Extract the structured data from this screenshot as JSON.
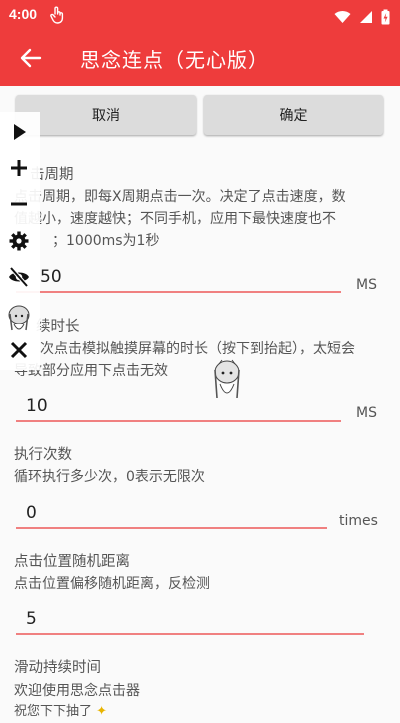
{
  "status": {
    "time": "4:00"
  },
  "app": {
    "title": "思念连点（无心版）"
  },
  "actions": {
    "cancel": "取消",
    "confirm": "确定"
  },
  "settings": {
    "period": {
      "label": "点击周期",
      "label_visible": "击周期",
      "desc_line1": "点击周期，即每X周期点击一次。决定了点击速度，数",
      "desc_line2": "值越小，速度越快；不同手机，应用下最快速度也不",
      "desc_line3": "；1000ms为1秒",
      "value_visible": "50",
      "unit": "MS"
    },
    "duration": {
      "label_visible": "续时长",
      "desc_line1": "次点击模拟触摸屏幕的时长（按下到抬起），太短会",
      "desc_line2": "导致部分应用下点击无效",
      "value": "10",
      "unit": "MS"
    },
    "count": {
      "label": "执行次数",
      "desc": "循环执行多少次，0表示无限次",
      "value": "0",
      "unit": "times"
    },
    "offset": {
      "label": "点击位置随机距离",
      "desc": "点击位置偏移随机距离，反检测",
      "value": "5"
    },
    "swipe": {
      "label": "滑动持续时间"
    }
  },
  "footer": {
    "line1": "欢迎使用思念点击器",
    "line2": "祝您下下抽了"
  },
  "floating_toolbar": [
    "play-icon",
    "plus-icon",
    "minus-icon",
    "gear-icon",
    "eye-off-icon",
    "close-icon"
  ]
}
